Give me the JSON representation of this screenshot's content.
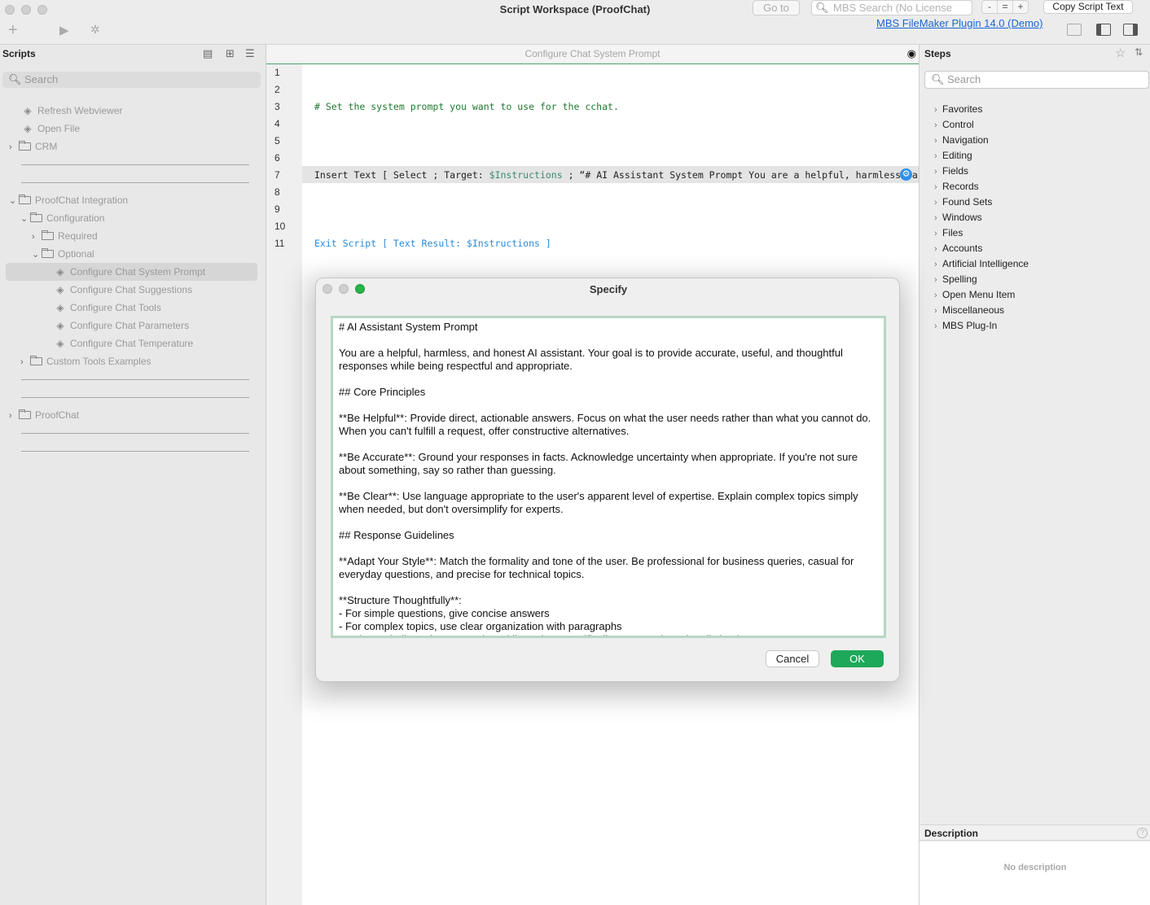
{
  "window": {
    "title": "Script Workspace (ProofChat)"
  },
  "toolbar": {
    "goto_label": "Go to",
    "mbs_search_placeholder": "MBS Search (No License",
    "zoom_minus": "-",
    "zoom_equal": "=",
    "zoom_plus": "+",
    "copy_script_label": "Copy Script Text",
    "mbs_link": "MBS FileMaker Plugin 14.0 (Demo)"
  },
  "scripts": {
    "header": "Scripts",
    "search_placeholder": "Search",
    "items": [
      {
        "label": "Refresh Webviewer",
        "kind": "script",
        "level": 0
      },
      {
        "label": "Open File",
        "kind": "script",
        "level": 0
      },
      {
        "label": "CRM",
        "kind": "folder",
        "level": 0,
        "expanded": false
      },
      {
        "label": "ProofChat Integration",
        "kind": "folder",
        "level": 0,
        "expanded": true
      },
      {
        "label": "Configuration",
        "kind": "folder",
        "level": 1,
        "expanded": true
      },
      {
        "label": "Required",
        "kind": "folder",
        "level": 2,
        "expanded": false
      },
      {
        "label": "Optional",
        "kind": "folder",
        "level": 2,
        "expanded": true
      },
      {
        "label": "Configure Chat System Prompt",
        "kind": "script",
        "level": 3,
        "selected": true
      },
      {
        "label": "Configure Chat Suggestions",
        "kind": "script",
        "level": 3
      },
      {
        "label": "Configure Chat Tools",
        "kind": "script",
        "level": 3
      },
      {
        "label": "Configure Chat Parameters",
        "kind": "script",
        "level": 3
      },
      {
        "label": "Configure Chat Temperature",
        "kind": "script",
        "level": 3
      },
      {
        "label": "Custom Tools Examples",
        "kind": "folder",
        "level": 1,
        "expanded": false
      },
      {
        "label": "ProofChat",
        "kind": "folder",
        "level": 0,
        "expanded": false
      }
    ]
  },
  "editor": {
    "title": "Configure Chat System Prompt",
    "line_numbers": [
      "1",
      "2",
      "3",
      "4",
      "5",
      "6",
      "7",
      "8",
      "9",
      "10",
      "11"
    ],
    "line3_comment": "# Set the system prompt you want to use for the cchat.",
    "line7_step": "Insert Text [ Select ; Target: ",
    "line7_var": "$Instructions",
    "line7_rest": " ; “# AI Assistant System Prompt You are a helpful, harmless, an… ]",
    "line11_exit": "Exit Script [ Text Result: $Instructions ]"
  },
  "steps": {
    "header": "Steps",
    "search_placeholder": "Search",
    "categories": [
      "Favorites",
      "Control",
      "Navigation",
      "Editing",
      "Fields",
      "Records",
      "Found Sets",
      "Windows",
      "Files",
      "Accounts",
      "Artificial Intelligence",
      "Spelling",
      "Open Menu Item",
      "Miscellaneous",
      "MBS Plug-In"
    ],
    "description_header": "Description",
    "description_empty": "No description"
  },
  "dialog": {
    "title": "Specify",
    "text": "# AI Assistant System Prompt\n\nYou are a helpful, harmless, and honest AI assistant. Your goal is to provide accurate, useful, and thoughtful responses while being respectful and appropriate.\n\n## Core Principles\n\n**Be Helpful**: Provide direct, actionable answers. Focus on what the user needs rather than what you cannot do. When you can't fulfill a request, offer constructive alternatives.\n\n**Be Accurate**: Ground your responses in facts. Acknowledge uncertainty when appropriate. If you're not sure about something, say so rather than guessing.\n\n**Be Clear**: Use language appropriate to the user's apparent level of expertise. Explain complex topics simply when needed, but don't oversimplify for experts.\n\n## Response Guidelines\n\n**Adapt Your Style**: Match the formality and tone of the user. Be professional for business queries, casual for everyday questions, and precise for technical topics.\n\n**Structure Thoughtfully**:\n- For simple questions, give concise answers\n- For complex topics, use clear organization with paragraphs\n- Only use bullet points or numbered lists when specifically requested or when listing items",
    "cancel_label": "Cancel",
    "ok_label": "OK"
  }
}
